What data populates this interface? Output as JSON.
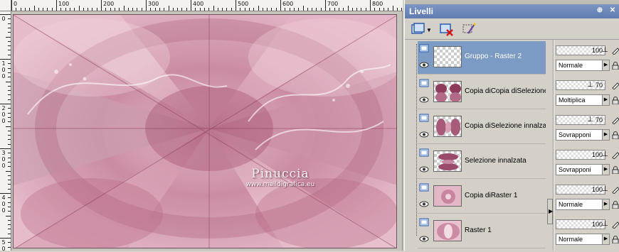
{
  "panel": {
    "title": "Livelli",
    "pin_glyph": "⊕",
    "close_glyph": "✕"
  },
  "ruler": {
    "top_labels": [
      "0",
      "100",
      "200",
      "300",
      "400",
      "500",
      "600",
      "700",
      "800"
    ],
    "left_labels": [
      "0",
      "1 0 0",
      "2 0 0",
      "3 0 0",
      "4 0 0",
      "5 0"
    ]
  },
  "watermark": {
    "name": "Pinuccia",
    "url": "www.maildigrafica.eu"
  },
  "layers": [
    {
      "name": "Gruppo - Raster 2",
      "opacity": "100",
      "blend": "Normale",
      "selected": true,
      "thumb": "blank"
    },
    {
      "name": "Copia diCopia diSelezione in",
      "opacity": "70",
      "blend": "Moltiplica",
      "selected": false,
      "thumb": "pink1"
    },
    {
      "name": "Copia diSelezione innalzata",
      "opacity": "70",
      "blend": "Sovrapponi",
      "selected": false,
      "thumb": "pink2"
    },
    {
      "name": "Selezione innalzata",
      "opacity": "100",
      "blend": "Sovrapponi",
      "selected": false,
      "thumb": "pink3"
    },
    {
      "name": "Copia diRaster 1",
      "opacity": "100",
      "blend": "Normale",
      "selected": false,
      "thumb": "pink4"
    },
    {
      "name": "Raster 1",
      "opacity": "100",
      "blend": "Normale",
      "selected": false,
      "thumb": "pink5"
    }
  ],
  "colors": {
    "selected_row": "#7b9ac4",
    "title_bar": "#6f89bc",
    "image_base": "#d7a3b6"
  }
}
